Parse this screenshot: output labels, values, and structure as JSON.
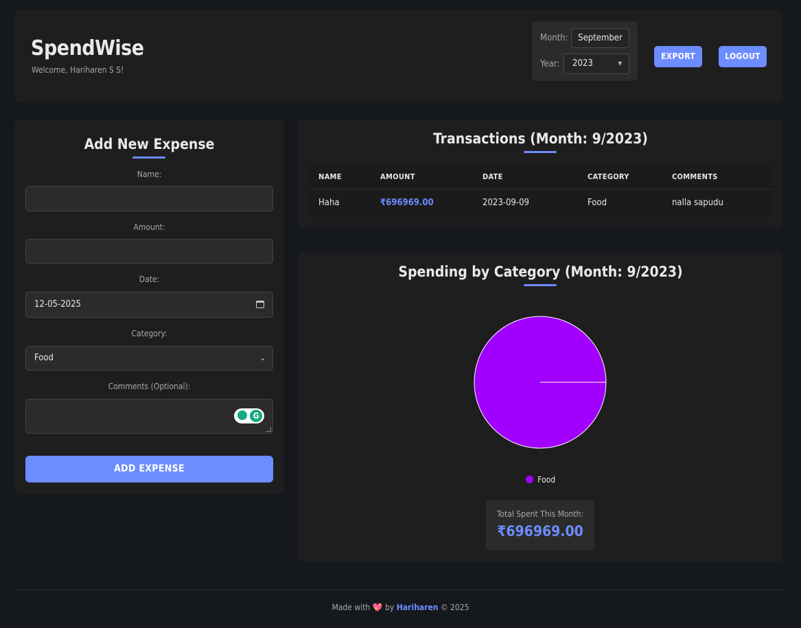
{
  "header": {
    "title": "SpendWise",
    "welcome": "Welcome, Hariharen S S!",
    "month_label": "Month:",
    "month_value": "September",
    "year_label": "Year:",
    "year_value": "2023",
    "export_label": "EXPORT",
    "logout_label": "LOGOUT"
  },
  "form": {
    "title": "Add New Expense",
    "name_label": "Name:",
    "name_value": "",
    "amount_label": "Amount:",
    "amount_value": "",
    "date_label": "Date:",
    "date_value": "12-05-2025",
    "category_label": "Category:",
    "category_value": "Food",
    "comments_label": "Comments (Optional):",
    "comments_value": "",
    "submit_label": "ADD EXPENSE"
  },
  "transactions": {
    "title": "Transactions (Month: 9/2023)",
    "columns": [
      "NAME",
      "AMOUNT",
      "DATE",
      "CATEGORY",
      "COMMENTS"
    ],
    "rows": [
      {
        "name": "Haha",
        "amount": "₹696969.00",
        "date": "2023-09-09",
        "category": "Food",
        "comments": "nalla sapudu"
      }
    ]
  },
  "spending": {
    "title": "Spending by Category (Month: 9/2023)",
    "total_label": "Total Spent This Month:",
    "total_value": "₹696969.00"
  },
  "chart_data": {
    "type": "pie",
    "categories": [
      "Food"
    ],
    "values": [
      696969.0
    ],
    "colors": [
      "#a100ff"
    ],
    "legend": "bottom"
  },
  "colors": {
    "accent": "#6c8cff",
    "pie_food": "#a100ff",
    "background": "#15181d",
    "card": "#1e1e1f"
  },
  "footer": {
    "made_with": "Made with",
    "heart": "💖",
    "by": "by",
    "author": "Hariharen",
    "copyright": "© 2025"
  }
}
